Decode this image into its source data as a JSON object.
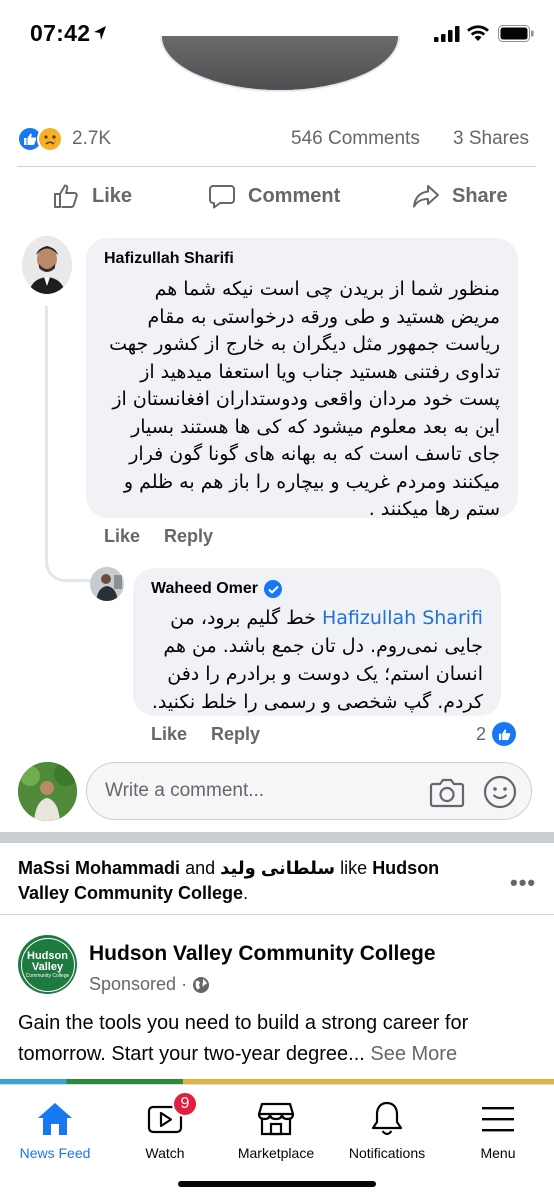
{
  "status_bar": {
    "time": "07:42"
  },
  "reactions": {
    "count": "2.7K",
    "comments": "546 Comments",
    "shares": "3 Shares"
  },
  "actions": {
    "like": "Like",
    "comment": "Comment",
    "share": "Share"
  },
  "comments": [
    {
      "author": "Hafizullah Sharifi",
      "text": "منظور شما از بریدن چی است نیکه شما هم مریض هستید و طی ورقه درخواستی به مقام ریاست جمهور مثل دیگران به خارج از کشور جهت تداوی رفتنی هستید جناب ویا استعفا میدهید از پست خود مردان واقعی ودوستداران افغانستان از این به بعد معلوم میشود که کی ها هستند بسیار جای تاسف است که به بهانه های گونا گون فرار میکنند ومردم غریب و بیچاره را باز هم به ظلم و ستم رها میکنند .",
      "like": "Like",
      "reply": "Reply"
    },
    {
      "author": "Waheed Omer",
      "mention": "Hafizullah Sharifi",
      "text": "خط گلیم برود، من جایی نمی‌روم. دل تان جمع باشد. من هم انسان استم؛ یک دوست و برادرم را دفن کردم. گپ شخصی و رسمی را خلط نکنید.",
      "like": "Like",
      "reply": "Reply",
      "like_count": "2"
    }
  ],
  "write_comment": {
    "placeholder": "Write a comment..."
  },
  "suggested": {
    "friend1": "MaSsi Mohammadi",
    "and": "and",
    "friend2": "سلطانی ولید",
    "like_text": "like",
    "page_ref": "Hudson Valley Community College",
    "page_name": "Hudson Valley Community College",
    "sponsored": "Sponsored · ",
    "post_text": "Gain the tools you need to build a strong career for tomorrow. Start your two-year degree... ",
    "see_more": "See More",
    "logo_line1": "Hudson",
    "logo_line2": "Valley",
    "logo_line3": "Community College"
  },
  "tabs": [
    {
      "label": "News Feed",
      "icon": "home-icon",
      "active": true
    },
    {
      "label": "Watch",
      "icon": "watch-icon",
      "badge": "9"
    },
    {
      "label": "Marketplace",
      "icon": "marketplace-icon"
    },
    {
      "label": "Notifications",
      "icon": "bell-icon"
    },
    {
      "label": "Menu",
      "icon": "menu-icon"
    }
  ],
  "colors": {
    "accent": "#1877f2",
    "secondary_text": "#65676b",
    "bubble": "#f0f2f5",
    "badge": "#e41e3f"
  }
}
